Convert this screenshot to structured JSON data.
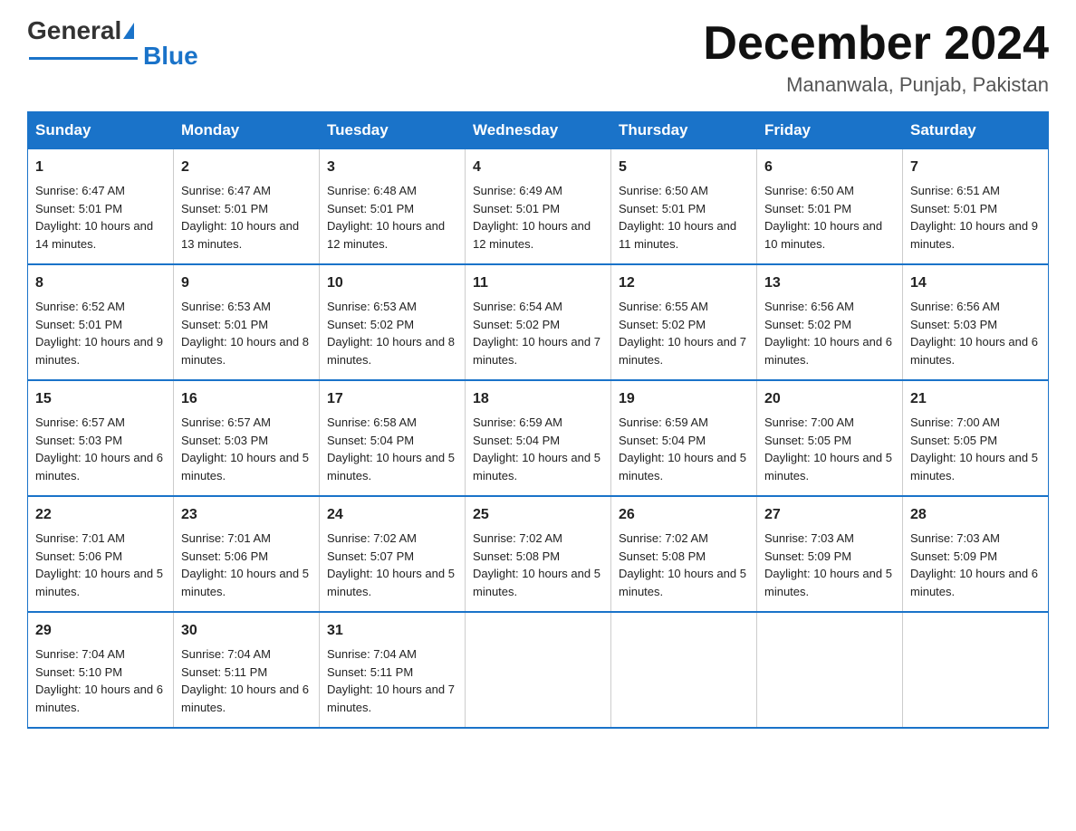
{
  "header": {
    "logo_text_black": "General",
    "logo_text_blue": "Blue",
    "month_year": "December 2024",
    "location": "Mananwala, Punjab, Pakistan"
  },
  "days_of_week": [
    "Sunday",
    "Monday",
    "Tuesday",
    "Wednesday",
    "Thursday",
    "Friday",
    "Saturday"
  ],
  "weeks": [
    [
      {
        "day": "1",
        "sunrise": "6:47 AM",
        "sunset": "5:01 PM",
        "daylight": "10 hours and 14 minutes."
      },
      {
        "day": "2",
        "sunrise": "6:47 AM",
        "sunset": "5:01 PM",
        "daylight": "10 hours and 13 minutes."
      },
      {
        "day": "3",
        "sunrise": "6:48 AM",
        "sunset": "5:01 PM",
        "daylight": "10 hours and 12 minutes."
      },
      {
        "day": "4",
        "sunrise": "6:49 AM",
        "sunset": "5:01 PM",
        "daylight": "10 hours and 12 minutes."
      },
      {
        "day": "5",
        "sunrise": "6:50 AM",
        "sunset": "5:01 PM",
        "daylight": "10 hours and 11 minutes."
      },
      {
        "day": "6",
        "sunrise": "6:50 AM",
        "sunset": "5:01 PM",
        "daylight": "10 hours and 10 minutes."
      },
      {
        "day": "7",
        "sunrise": "6:51 AM",
        "sunset": "5:01 PM",
        "daylight": "10 hours and 9 minutes."
      }
    ],
    [
      {
        "day": "8",
        "sunrise": "6:52 AM",
        "sunset": "5:01 PM",
        "daylight": "10 hours and 9 minutes."
      },
      {
        "day": "9",
        "sunrise": "6:53 AM",
        "sunset": "5:01 PM",
        "daylight": "10 hours and 8 minutes."
      },
      {
        "day": "10",
        "sunrise": "6:53 AM",
        "sunset": "5:02 PM",
        "daylight": "10 hours and 8 minutes."
      },
      {
        "day": "11",
        "sunrise": "6:54 AM",
        "sunset": "5:02 PM",
        "daylight": "10 hours and 7 minutes."
      },
      {
        "day": "12",
        "sunrise": "6:55 AM",
        "sunset": "5:02 PM",
        "daylight": "10 hours and 7 minutes."
      },
      {
        "day": "13",
        "sunrise": "6:56 AM",
        "sunset": "5:02 PM",
        "daylight": "10 hours and 6 minutes."
      },
      {
        "day": "14",
        "sunrise": "6:56 AM",
        "sunset": "5:03 PM",
        "daylight": "10 hours and 6 minutes."
      }
    ],
    [
      {
        "day": "15",
        "sunrise": "6:57 AM",
        "sunset": "5:03 PM",
        "daylight": "10 hours and 6 minutes."
      },
      {
        "day": "16",
        "sunrise": "6:57 AM",
        "sunset": "5:03 PM",
        "daylight": "10 hours and 5 minutes."
      },
      {
        "day": "17",
        "sunrise": "6:58 AM",
        "sunset": "5:04 PM",
        "daylight": "10 hours and 5 minutes."
      },
      {
        "day": "18",
        "sunrise": "6:59 AM",
        "sunset": "5:04 PM",
        "daylight": "10 hours and 5 minutes."
      },
      {
        "day": "19",
        "sunrise": "6:59 AM",
        "sunset": "5:04 PM",
        "daylight": "10 hours and 5 minutes."
      },
      {
        "day": "20",
        "sunrise": "7:00 AM",
        "sunset": "5:05 PM",
        "daylight": "10 hours and 5 minutes."
      },
      {
        "day": "21",
        "sunrise": "7:00 AM",
        "sunset": "5:05 PM",
        "daylight": "10 hours and 5 minutes."
      }
    ],
    [
      {
        "day": "22",
        "sunrise": "7:01 AM",
        "sunset": "5:06 PM",
        "daylight": "10 hours and 5 minutes."
      },
      {
        "day": "23",
        "sunrise": "7:01 AM",
        "sunset": "5:06 PM",
        "daylight": "10 hours and 5 minutes."
      },
      {
        "day": "24",
        "sunrise": "7:02 AM",
        "sunset": "5:07 PM",
        "daylight": "10 hours and 5 minutes."
      },
      {
        "day": "25",
        "sunrise": "7:02 AM",
        "sunset": "5:08 PM",
        "daylight": "10 hours and 5 minutes."
      },
      {
        "day": "26",
        "sunrise": "7:02 AM",
        "sunset": "5:08 PM",
        "daylight": "10 hours and 5 minutes."
      },
      {
        "day": "27",
        "sunrise": "7:03 AM",
        "sunset": "5:09 PM",
        "daylight": "10 hours and 5 minutes."
      },
      {
        "day": "28",
        "sunrise": "7:03 AM",
        "sunset": "5:09 PM",
        "daylight": "10 hours and 6 minutes."
      }
    ],
    [
      {
        "day": "29",
        "sunrise": "7:04 AM",
        "sunset": "5:10 PM",
        "daylight": "10 hours and 6 minutes."
      },
      {
        "day": "30",
        "sunrise": "7:04 AM",
        "sunset": "5:11 PM",
        "daylight": "10 hours and 6 minutes."
      },
      {
        "day": "31",
        "sunrise": "7:04 AM",
        "sunset": "5:11 PM",
        "daylight": "10 hours and 7 minutes."
      },
      null,
      null,
      null,
      null
    ]
  ],
  "labels": {
    "sunrise": "Sunrise:",
    "sunset": "Sunset:",
    "daylight": "Daylight:"
  }
}
